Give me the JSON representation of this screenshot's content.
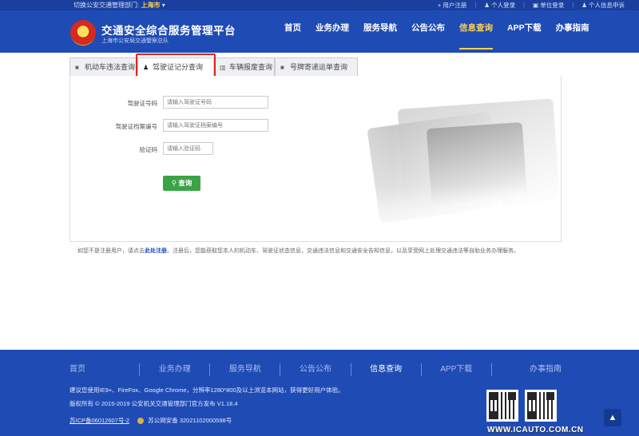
{
  "topbar": {
    "switch_label": "切换公安交通管理部门:",
    "city": "上海市",
    "links": [
      "用户注册",
      "个人登录",
      "单位登录",
      "个人信息申诉"
    ]
  },
  "header": {
    "title": "交通安全综合服务管理平台",
    "subtitle": "上海市公安局交通警察总队",
    "nav": [
      "首页",
      "业务办理",
      "服务导航",
      "公告公布",
      "信息查询",
      "APP下载",
      "办事指南"
    ],
    "active_nav": "信息查询"
  },
  "tabs": [
    {
      "label": "机动车违法查询",
      "icon": "car-icon"
    },
    {
      "label": "驾驶证记分查询",
      "icon": "person-icon"
    },
    {
      "label": "车辆报废查询",
      "icon": "trash-icon"
    },
    {
      "label": "号牌寄递运单查询",
      "icon": "truck-icon"
    }
  ],
  "form": {
    "license_label": "驾驶证号码",
    "license_placeholder": "请输入驾驶证号码",
    "file_label": "驾驶证档案编号",
    "file_placeholder": "请输入驾驶证档案编号",
    "captcha_label": "验证码",
    "captcha_placeholder": "请输入验证码",
    "query_button": "查询"
  },
  "note": {
    "prefix": "如您不是注册用户，请点击",
    "link": "此处注册",
    "suffix": "。注册后，您能获取您本人的机动车、驾驶证状态信息，交通违法信息和交通安全告知信息，以及享受网上处理交通违法等自助业务办理服务。"
  },
  "footer": {
    "nav": [
      "首页",
      "业务办理",
      "服务导航",
      "公告公布",
      "信息查询",
      "APP下载",
      "办事指南"
    ],
    "active_nav": "信息查询",
    "browser_tip": "建议您使用IE9+、FireFox、Google Chrome，分辨率1280*800及以上浏览本网站，获得更好用户体验。",
    "copyright": "版权所有 © 2015-2019 公安机关交通管理部门官方发布 V1.18.4",
    "icp": "苏ICP备06012607号-2",
    "gongan": "苏公网安备 32021102000598号"
  },
  "watermark": "WWW.ICAUTO.COM.CN"
}
